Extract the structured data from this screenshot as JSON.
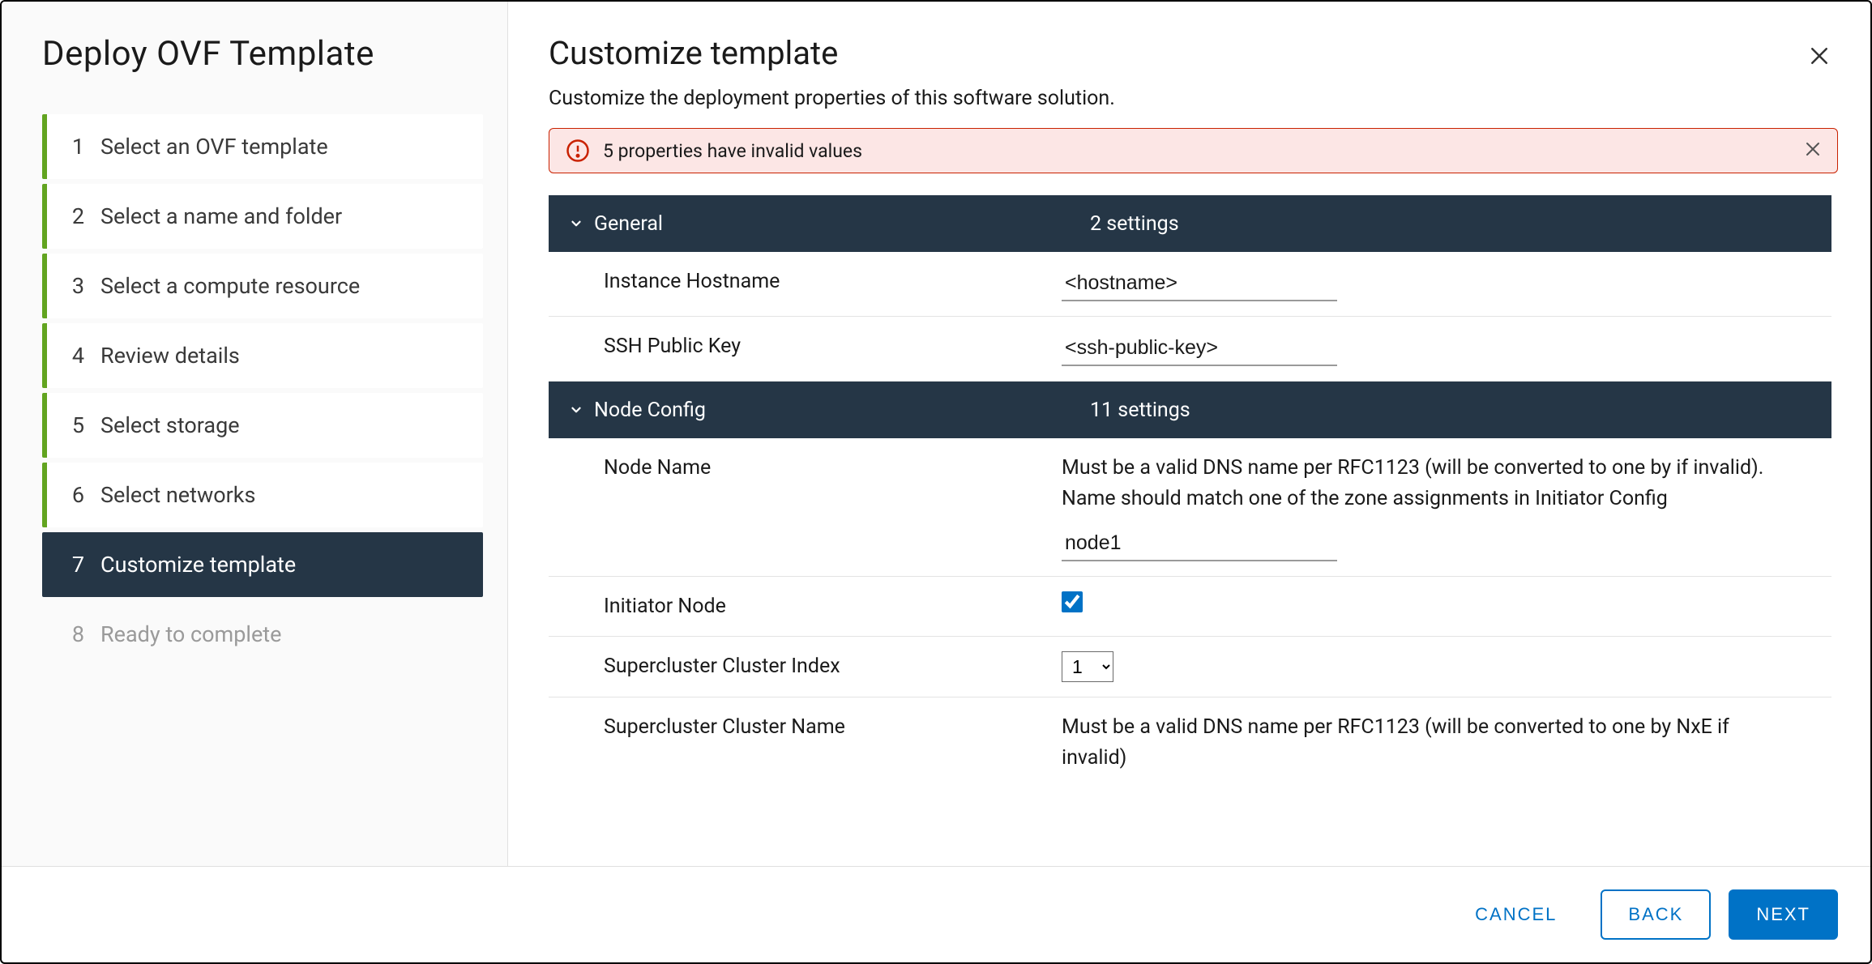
{
  "wizard": {
    "title": "Deploy OVF Template",
    "steps": [
      {
        "num": "1",
        "label": "Select an OVF template",
        "state": "completed"
      },
      {
        "num": "2",
        "label": "Select a name and folder",
        "state": "completed"
      },
      {
        "num": "3",
        "label": "Select a compute resource",
        "state": "completed"
      },
      {
        "num": "4",
        "label": "Review details",
        "state": "completed"
      },
      {
        "num": "5",
        "label": "Select storage",
        "state": "completed"
      },
      {
        "num": "6",
        "label": "Select networks",
        "state": "completed"
      },
      {
        "num": "7",
        "label": "Customize template",
        "state": "active"
      },
      {
        "num": "8",
        "label": "Ready to complete",
        "state": "disabled"
      }
    ]
  },
  "page": {
    "title": "Customize template",
    "subtitle": "Customize the deployment properties of this software solution."
  },
  "alert": {
    "text": "5 properties have invalid values"
  },
  "sections": {
    "general": {
      "title": "General",
      "meta": "2 settings",
      "rows": {
        "instanceHostname": {
          "label": "Instance Hostname",
          "value": "<hostname>"
        },
        "sshPublicKey": {
          "label": "SSH Public Key",
          "value": "<ssh-public-key>"
        }
      }
    },
    "nodeConfig": {
      "title": "Node Config",
      "meta": "11 settings",
      "rows": {
        "nodeName": {
          "label": "Node Name",
          "desc": "Must be a valid DNS name per RFC1123 (will be converted to one by if invalid). Name should match one of the zone assignments in Initiator Config",
          "value": "node1"
        },
        "initiatorNode": {
          "label": "Initiator Node",
          "checked": true
        },
        "superclusterIndex": {
          "label": "Supercluster Cluster Index",
          "value": "1"
        },
        "superclusterName": {
          "label": "Supercluster Cluster Name",
          "desc": "Must be a valid DNS name per RFC1123 (will be converted to one by NxE if invalid)"
        }
      }
    }
  },
  "footer": {
    "cancel": "CANCEL",
    "back": "BACK",
    "next": "NEXT"
  }
}
